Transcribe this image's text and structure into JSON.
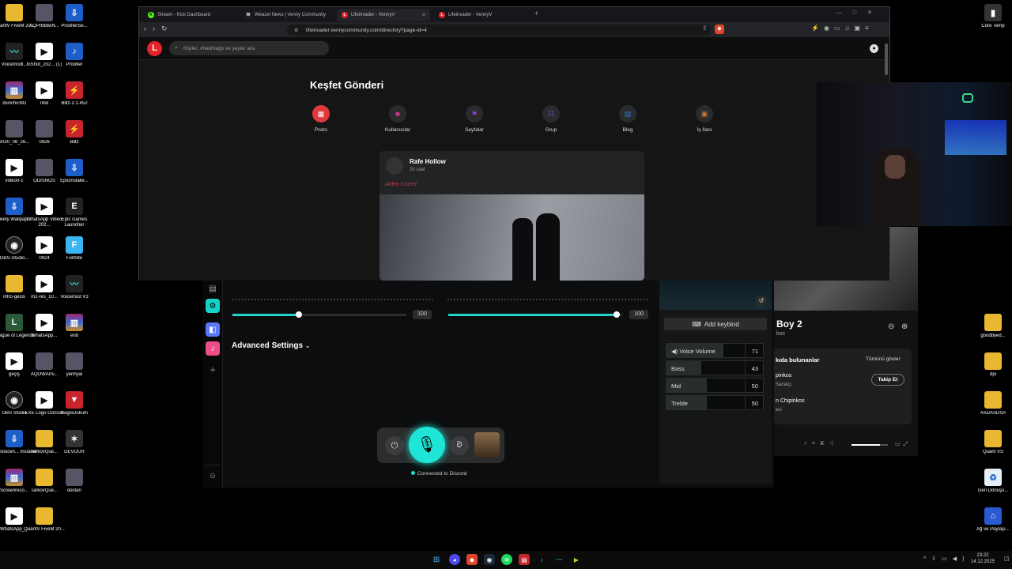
{
  "desktop": {
    "left_icons": [
      {
        "label": "QuantV FiveM 20...",
        "icon": "folder"
      },
      {
        "label": "AQPrBBlwN...",
        "icon": "image"
      },
      {
        "label": "ProofierSe...",
        "icon": "installer"
      },
      {
        "label": "Voicemodl...",
        "icon": "voicemod"
      },
      {
        "label": "InShot_202... (1)",
        "icon": "video"
      },
      {
        "label": "Proofier",
        "icon": "app"
      },
      {
        "label": "35inchENG",
        "icon": "rar"
      },
      {
        "label": "nbd",
        "icon": "video"
      },
      {
        "label": "Blitz-2.1.452",
        "icon": "blitz"
      },
      {
        "label": "2020_06_26...",
        "icon": "image"
      },
      {
        "label": "0926",
        "icon": "image"
      },
      {
        "label": "Blitz",
        "icon": "blitz"
      },
      {
        "label": "video0-1",
        "icon": "video"
      },
      {
        "label": "ODISNOS",
        "icon": "image"
      },
      {
        "label": "EpicInstalle...",
        "icon": "installer"
      },
      {
        "label": "Lively Wallpap...",
        "icon": "installer"
      },
      {
        "label": "WhatsApp Video 202...",
        "icon": "video"
      },
      {
        "label": "Epic Games Launcher",
        "icon": "epic"
      },
      {
        "label": "OBS-Studio...",
        "icon": "obs"
      },
      {
        "label": "0924",
        "icon": "video"
      },
      {
        "label": "Fortnite",
        "icon": "fortnite"
      },
      {
        "label": "intro-gecis",
        "icon": "folder"
      },
      {
        "label": "m2-res_10...",
        "icon": "video"
      },
      {
        "label": "Voicemod V3",
        "icon": "voicemod"
      },
      {
        "label": "League of Legends",
        "icon": "lol"
      },
      {
        "label": "WhatsApp...",
        "icon": "video"
      },
      {
        "label": "enb",
        "icon": "rar"
      },
      {
        "label": "geçiş",
        "icon": "video"
      },
      {
        "label": "AQOWAPv...",
        "icon": "image"
      },
      {
        "label": "yennyai",
        "icon": "image"
      },
      {
        "label": "OBS Studio",
        "icon": "obs"
      },
      {
        "label": "EXE Logo Gözsüz",
        "icon": "video"
      },
      {
        "label": "BagisDokum",
        "icon": "shield"
      },
      {
        "label": "Translucen... Installer",
        "icon": "installer"
      },
      {
        "label": "TarkovQue...",
        "icon": "folder"
      },
      {
        "label": "DEVOUR",
        "icon": "devour"
      },
      {
        "label": "Screenreco...",
        "icon": "rar"
      },
      {
        "label": "TarkovQue...",
        "icon": "folder"
      },
      {
        "label": "declan",
        "icon": "image"
      },
      {
        "label": "WhatsApp_...",
        "icon": "video"
      },
      {
        "label": "QuantV FiveM 20...",
        "icon": "folder"
      }
    ],
    "right_icons": [
      {
        "label": "Core Temp",
        "icon": "coretemp"
      },
      {
        "label": "goodbyed...",
        "icon": "folder"
      },
      {
        "label": "dpi",
        "icon": "folder"
      },
      {
        "label": "ASDASDSA",
        "icon": "folder"
      },
      {
        "label": "Quant VS",
        "icon": "folder"
      },
      {
        "label": "Geri Dönüşü...",
        "icon": "recycle"
      },
      {
        "label": "Ağ ve Paylaşı...",
        "icon": "network"
      }
    ]
  },
  "browser": {
    "tabs": [
      {
        "label": "Stream - Kick Dashboard",
        "fav": "K",
        "active": false
      },
      {
        "label": "Weazel News | Venny Community",
        "fav": "W",
        "active": false
      },
      {
        "label": "Lifeinvader - VennyV",
        "fav": "L",
        "active": true
      },
      {
        "label": "Lifeinvader - VennyV",
        "fav": "L",
        "active": false
      }
    ],
    "new_tab": "+",
    "url": "lifeinvader.vennycommunity.com/directory?page-id=4"
  },
  "site": {
    "logo": "L",
    "search_placeholder": "Kişiler, #hashtags ve şeyler ara",
    "page_title": "Keşfet Gönderi",
    "categories": [
      {
        "label": "Posts",
        "color": "#e03a3e",
        "icon": "grid-icon"
      },
      {
        "label": "Kullanıcılar",
        "color": "#d23d8c",
        "icon": "users-icon"
      },
      {
        "label": "Sayfalar",
        "color": "#9a3ad0",
        "icon": "flag-icon"
      },
      {
        "label": "Grup",
        "color": "#7a4ad8",
        "icon": "group-icon"
      },
      {
        "label": "Blog",
        "color": "#2a7ad8",
        "icon": "blog-icon"
      },
      {
        "label": "İş İlanı",
        "color": "#e07a2a",
        "icon": "briefcase-icon"
      }
    ],
    "post": {
      "author": "Rafe Hollow",
      "time": "20 saat",
      "mention": "Aiden Cortez"
    }
  },
  "voicemod": {
    "slider1_value": "100",
    "slider2_value": "100",
    "slider1_level": 0.38,
    "slider2_level": 0.97,
    "advanced_settings": "Advanced Settings",
    "status": "Connected to Discord",
    "add_keybind": "Add keybind",
    "eq": [
      {
        "name": "Voice Volume",
        "value": "71",
        "level": 0.71
      },
      {
        "name": "Bass",
        "value": "43",
        "level": 0.43
      },
      {
        "name": "Mid",
        "value": "50",
        "level": 0.5
      },
      {
        "name": "Treble",
        "value": "50",
        "level": 0.5
      }
    ]
  },
  "spotify": {
    "title": "Boy 2",
    "subtitle": "kos",
    "section_title": "kıda bulunanlar",
    "show_all": "Tümünü göster",
    "artist1": "pinkos",
    "artist1_role": "Sanatçı",
    "follow": "Takip Et",
    "artist2": "n Chipinkos",
    "artist2_role": "eci"
  },
  "taskbar": {
    "time": "23:22",
    "date": "14.12.2025"
  }
}
